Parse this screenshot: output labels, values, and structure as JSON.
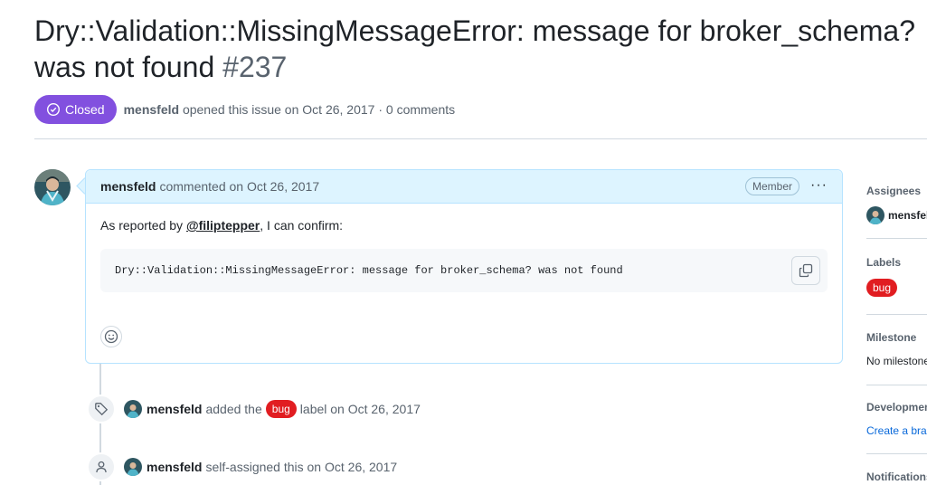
{
  "issue": {
    "title": "Dry::Validation::MissingMessageError: message for broker_schema? was not found",
    "number": "#237",
    "state": "Closed",
    "author": "mensfeld",
    "opened_text": "opened this issue on Oct 26, 2017",
    "separator": "·",
    "comments_count": "0 comments"
  },
  "comment": {
    "author": "mensfeld",
    "date_text": "commented on Oct 26, 2017",
    "role_badge": "Member",
    "more_label": "···",
    "body_prefix": "As reported by ",
    "mention": "@filiptepper",
    "body_suffix": ", I can confirm:",
    "code": "Dry::Validation::MissingMessageError: message for broker_schema? was not found"
  },
  "events": [
    {
      "actor": "mensfeld",
      "text_before": "added the",
      "label": "bug",
      "text_after": "label on Oct 26, 2017",
      "icon": "tag-icon"
    },
    {
      "actor": "mensfeld",
      "text": "self-assigned this on Oct 26, 2017",
      "icon": "person-icon"
    }
  ],
  "sidebar": {
    "assignees_title": "Assignees",
    "assignee": "mensfeld",
    "labels_title": "Labels",
    "label": "bug",
    "milestone_title": "Milestone",
    "milestone_value": "No milestone",
    "development_title": "Development",
    "development_link": "Create a branch",
    "notifications_title": "Notifications"
  },
  "colors": {
    "closed": "#8250df",
    "bug": "#e11d21",
    "comment_header": "#ddf4ff",
    "link": "#0969da"
  }
}
